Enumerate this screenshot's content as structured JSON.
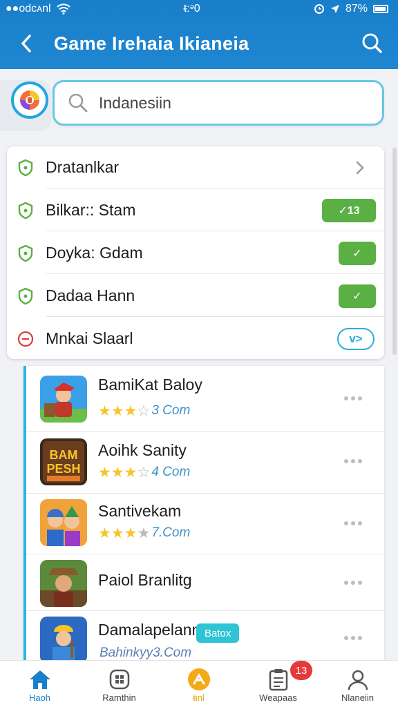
{
  "status_bar": {
    "carrier": "●●ᴏdcᴀnl",
    "time": "ᵵ:ᵊ0",
    "battery": "87%"
  },
  "header": {
    "title": "Game Irehaia Ikianeia"
  },
  "search": {
    "value": "Indanesiin"
  },
  "categories": [
    {
      "label": "Dratanlkar",
      "icon": "shield-icon",
      "icon_color": "#5ab043",
      "action": "chevron"
    },
    {
      "label": "Bilkar:: Stam",
      "icon": "shield-icon",
      "icon_color": "#5ab043",
      "badge": "✓13",
      "action": "badge"
    },
    {
      "label": "Doyka: Gdam",
      "icon": "shield-icon",
      "icon_color": "#5ab043",
      "badge": "✓",
      "action": "badge"
    },
    {
      "label": "Dadaa Hann",
      "icon": "shield-icon",
      "icon_color": "#5ab043",
      "badge": "✓",
      "action": "badge"
    },
    {
      "label": "Mnkai Slaarl",
      "icon": "minus-circle-icon",
      "icon_color": "#e03a3a",
      "badge": "v>",
      "action": "outline"
    }
  ],
  "games": [
    {
      "name": "BamiKat Baloy",
      "stars": 3,
      "rating_text": "3 Com",
      "thumb": "game-thumbnail-knight"
    },
    {
      "name": "Aoihk Sanity",
      "stars": 3,
      "rating_text": "4 Com",
      "thumb_text": "BAM PESH",
      "thumb": "game-thumbnail-title"
    },
    {
      "name": "Santivekam",
      "stars": 3,
      "rating_text": "7.Com",
      "thumb": "game-thumbnail-heroes"
    },
    {
      "name": "Paiol Branlitg",
      "thumb": "game-thumbnail-cowboy"
    },
    {
      "name": "Damalapelann",
      "tag": "Batox",
      "rating_text": "Bahinkyy3.Com",
      "thumb": "game-thumbnail-miner"
    }
  ],
  "bottom_nav": [
    {
      "label": "Haoh",
      "icon": "home-icon"
    },
    {
      "label": "Ramthin",
      "icon": "grid-icon"
    },
    {
      "label": "ᵵinl",
      "icon": "game-icon"
    },
    {
      "label": "Weapaas",
      "icon": "clipboard-icon",
      "badge": "13"
    },
    {
      "label": "Nlaneiin",
      "icon": "profile-icon"
    }
  ],
  "colors": {
    "primary": "#1a7fcb",
    "accent": "#27b6dc",
    "green": "#5ab043",
    "star": "#f7c52a"
  }
}
